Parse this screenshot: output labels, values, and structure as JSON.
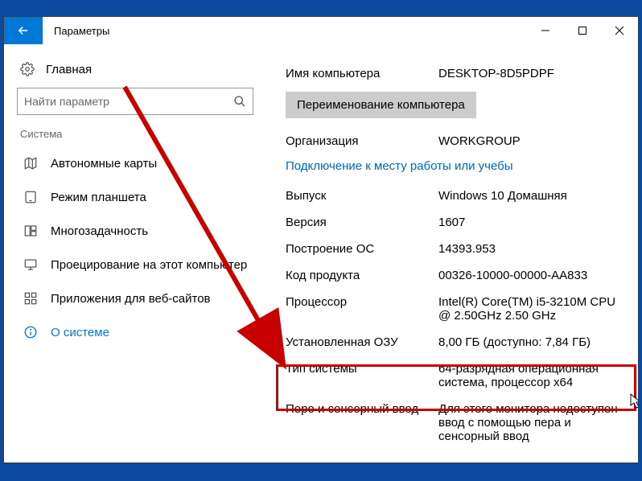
{
  "titlebar": {
    "title": "Параметры"
  },
  "sidebar": {
    "home": "Главная",
    "search_placeholder": "Найти параметр",
    "section": "Система",
    "items": [
      {
        "label": "Автономные карты"
      },
      {
        "label": "Режим планшета"
      },
      {
        "label": "Многозадачность"
      },
      {
        "label": "Проецирование на этот компьютер"
      },
      {
        "label": "Приложения для веб-сайтов"
      },
      {
        "label": "О системе"
      }
    ]
  },
  "main": {
    "computer_name_label": "Имя компьютера",
    "computer_name": "DESKTOP-8D5PDPF",
    "rename_button": "Переименование компьютера",
    "org_label": "Организация",
    "org_value": "WORKGROUP",
    "connect_link": "Подключение к месту работы или учебы",
    "edition_label": "Выпуск",
    "edition_value": "Windows 10 Домашняя",
    "version_label": "Версия",
    "version_value": "1607",
    "build_label": "Построение ОС",
    "build_value": "14393.953",
    "product_label": "Код продукта",
    "product_value": "00326-10000-00000-AA833",
    "cpu_label": "Процессор",
    "cpu_value": "Intel(R) Core(TM) i5-3210M CPU @ 2.50GHz   2.50 GHz",
    "ram_label": "Установленная ОЗУ",
    "ram_value": "8,00 ГБ (доступно: 7,84 ГБ)",
    "systype_label": "Тип системы",
    "systype_value": "64-разрядная операционная система, процессор x64",
    "pen_label": "Перо и сенсорный ввод",
    "pen_value": "Для этого монитора недоступен ввод с помощью пера и сенсорный ввод"
  }
}
